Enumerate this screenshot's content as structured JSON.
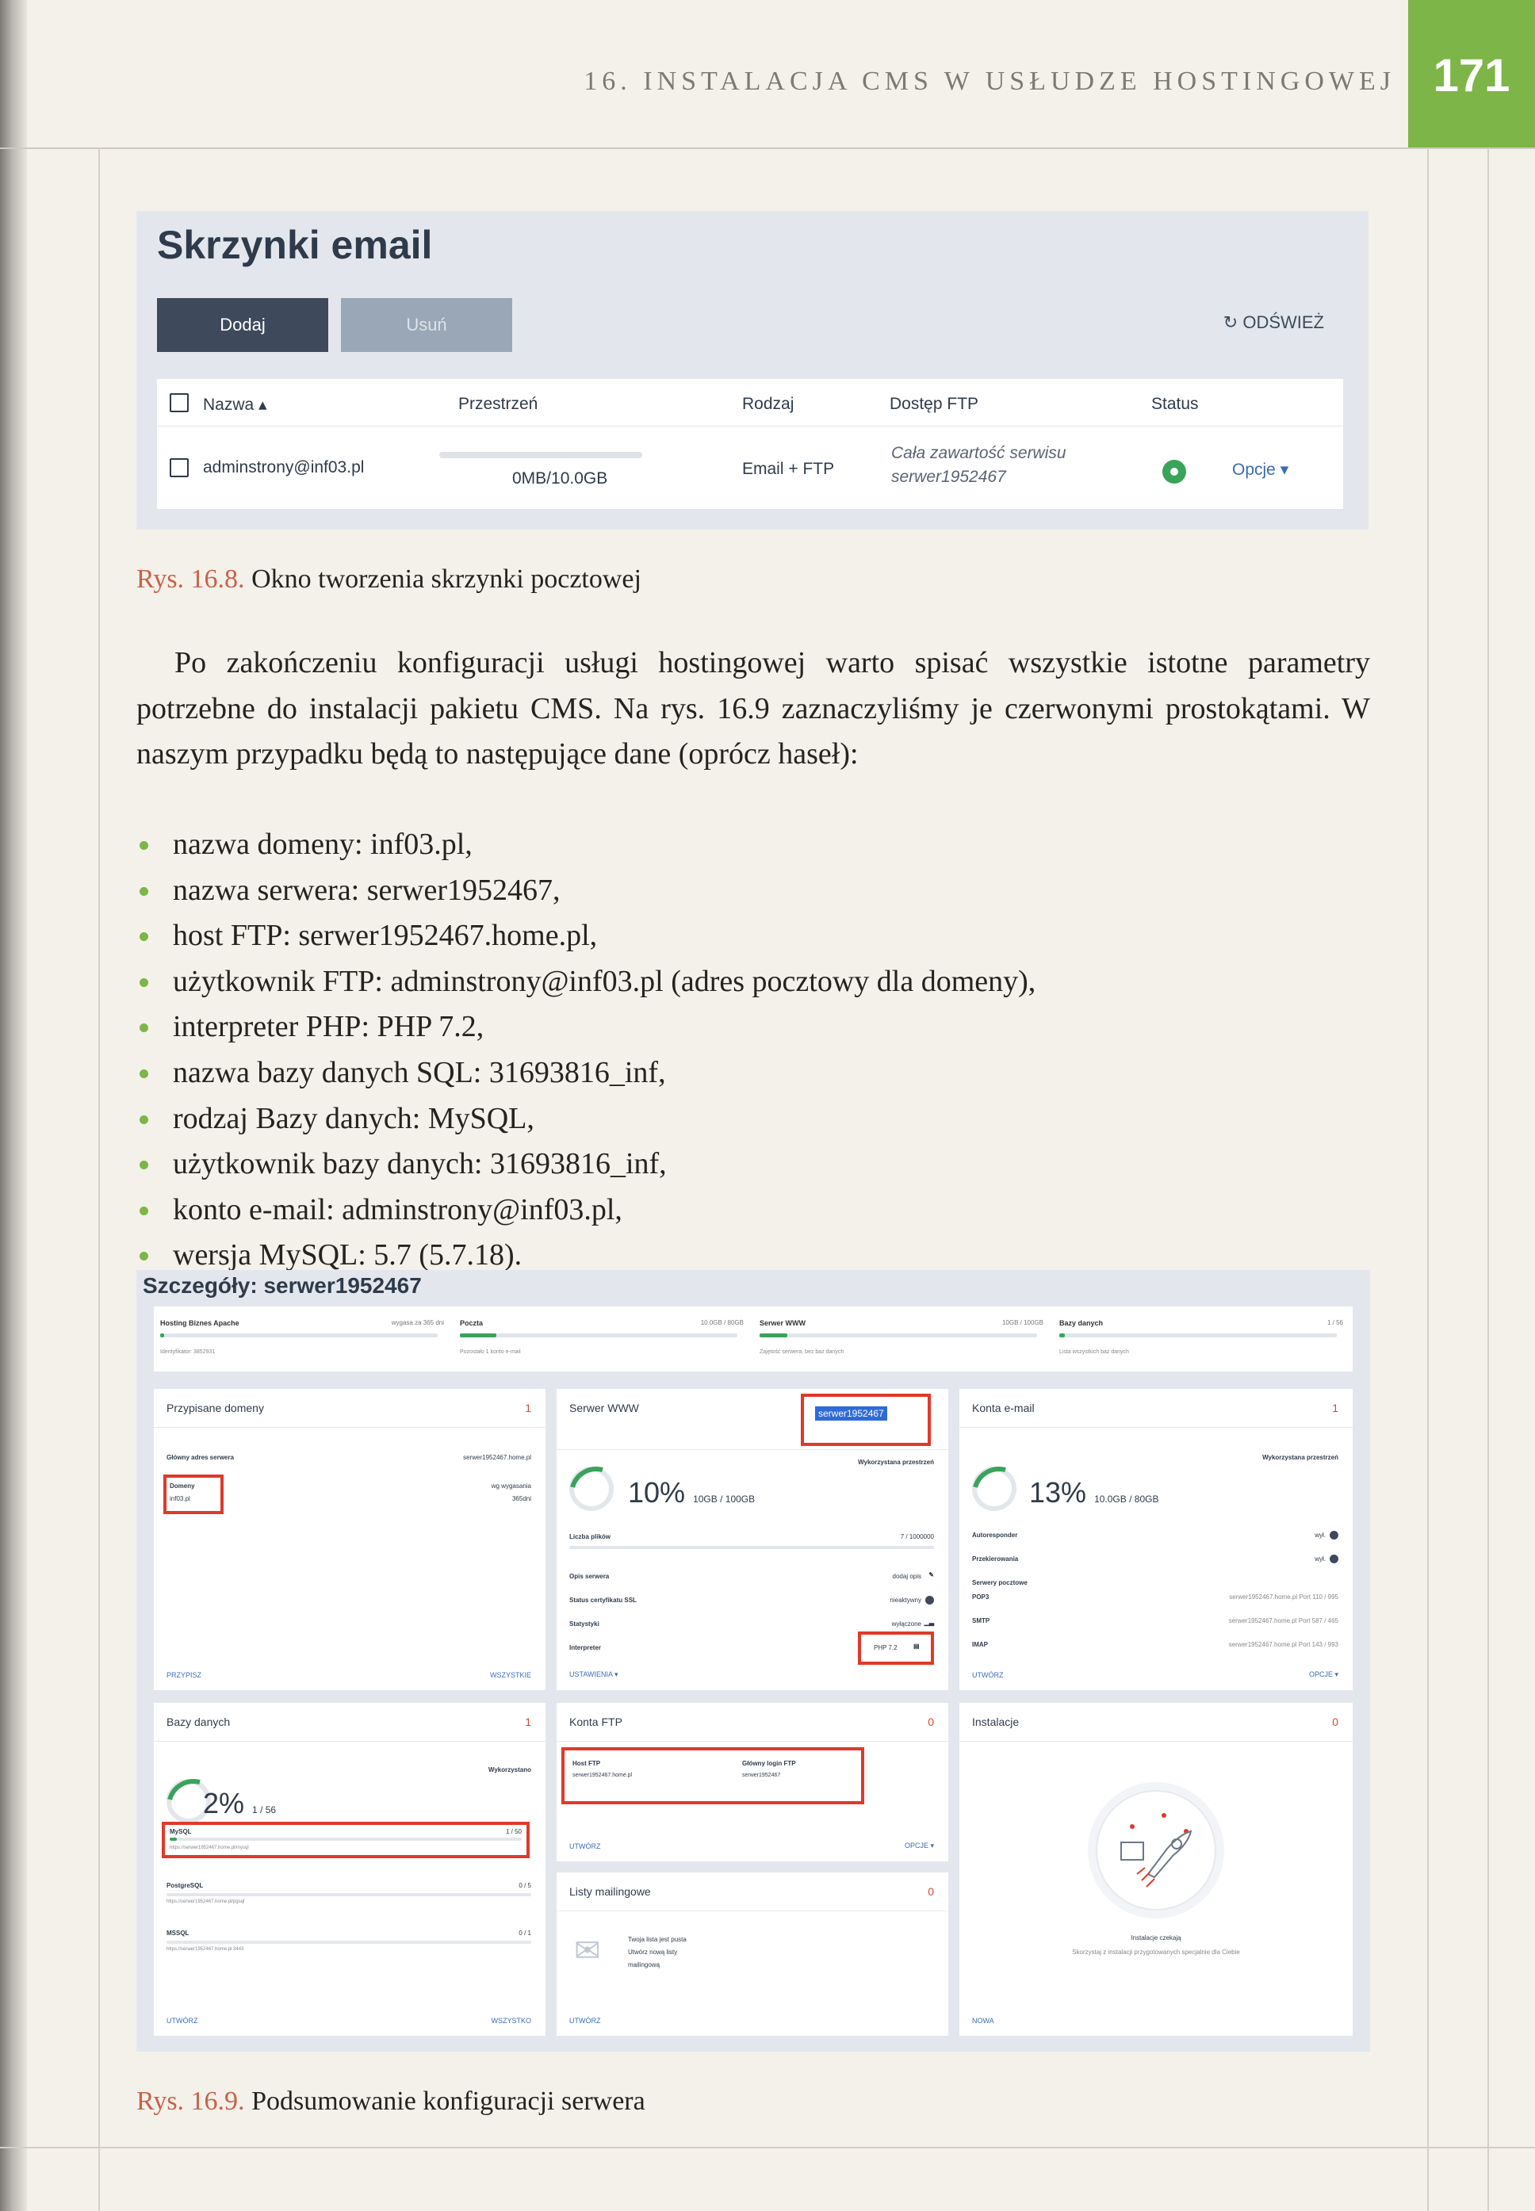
{
  "header": {
    "running_head": "16. INSTALACJA CMS W USŁUDZE HOSTINGOWEJ",
    "page_number": "171"
  },
  "fig1": {
    "title": "Skrzynki email",
    "add_label": "Dodaj",
    "delete_label": "Usuń",
    "refresh_label": "ODŚWIEŻ",
    "columns": [
      "Nazwa ▴",
      "Przestrzeń",
      "Rodzaj",
      "Dostęp FTP",
      "Status"
    ],
    "row": {
      "name": "adminstrony@inf03.pl",
      "space": "0MB/10.0GB",
      "type": "Email + FTP",
      "ftp_line1": "Cała zawartość serwisu",
      "ftp_line2": "serwer1952467",
      "options": "Opcje ▾"
    },
    "caption_num": "Rys. 16.8.",
    "caption_text": "Okno tworzenia skrzynki pocztowej"
  },
  "body": {
    "paragraph": "Po zakończeniu konfiguracji usługi hostingowej warto spisać wszystkie istotne parametry potrzebne do instalacji pakietu CMS. Na rys. 16.9 zaznaczyliśmy je czerwonymi prostokątami. W naszym przypadku będą to następujące dane (oprócz haseł):",
    "bullets": [
      "nazwa domeny: inf03.pl,",
      "nazwa serwera: serwer1952467,",
      "host FTP: serwer1952467.home.pl,",
      "użytkownik FTP: adminstrony@inf03.pl (adres pocztowy dla domeny),",
      "interpreter PHP: PHP 7.2,",
      "nazwa bazy danych SQL: 31693816_inf,",
      "rodzaj Bazy danych: MySQL,",
      "użytkownik bazy danych: 31693816_inf,",
      "konto e-mail: adminstrony@inf03.pl,",
      "wersja MySQL: 5.7 (5.7.18)."
    ]
  },
  "fig2": {
    "title": "Szczegóły: serwer1952467",
    "strip": [
      {
        "title": "Hosting Biznes Apache",
        "value": "wygasa za 365 dni",
        "sub": "Identyfikator: 3852931",
        "fill": 0.01
      },
      {
        "title": "Poczta",
        "value": "10.0GB / 80GB",
        "sub": "Pozostało 1 konto e-mail",
        "fill": 0.13
      },
      {
        "title": "Serwer WWW",
        "value": "10GB / 100GB",
        "sub": "Zajętość serwera, bez baz danych",
        "fill": 0.1
      },
      {
        "title": "Bazy danych",
        "value": "1 / 56",
        "sub": "Lista wszystkich baz danych",
        "fill": 0.02
      }
    ],
    "domains": {
      "title": "Przypisane domeny",
      "count": "1",
      "main_label": "Główny adres serwera",
      "main_value": "serwer1952467.home.pl",
      "domains_label": "Domeny",
      "domain": "inf03.pl",
      "expiry_label": "wg wygasania",
      "expiry_value": "365dni",
      "foot_left": "PRZYPISZ",
      "foot_right": "WSZYSTKIE"
    },
    "www": {
      "title": "Serwer WWW",
      "server": "serwer1952467",
      "used_label": "Wykorzystana przestrzeń",
      "percent": "10%",
      "amount": "10GB / 100GB",
      "files_label": "Liczba plików",
      "files_value": "7 / 1000000",
      "desc_label": "Opis serwera",
      "desc_value": "dodaj opis",
      "ssl_label": "Status certyfikatu SSL",
      "ssl_value": "nieaktywny",
      "stats_label": "Statystyki",
      "stats_value": "wyłączone",
      "php_label": "Interpreter",
      "php_value": "PHP 7.2",
      "foot_left": "USTAWIENIA ▾"
    },
    "mail": {
      "title": "Konta e-mail",
      "count": "1",
      "used_label": "Wykorzystana przestrzeń",
      "percent": "13%",
      "amount": "10.0GB / 80GB",
      "rows": [
        {
          "label": "Autoresponder",
          "value": "wył."
        },
        {
          "label": "Przekierowania",
          "value": "wył."
        },
        {
          "label": "Serwery pocztowe",
          "value": ""
        },
        {
          "label": "POP3",
          "value": "serwer1952467.home.pl   Port 110 / 995"
        },
        {
          "label": "SMTP",
          "value": "serwer1952467.home.pl   Port 587 / 465"
        },
        {
          "label": "IMAP",
          "value": "serwer1952467.home.pl   Port 143 / 993"
        }
      ],
      "foot_left": "UTWÓRZ",
      "foot_right": "OPCJE ▾"
    },
    "db": {
      "title": "Bazy danych",
      "count": "1",
      "used_label": "Wykorzystano",
      "percent": "2%",
      "amount": "1 / 56",
      "rows": [
        {
          "name": "MySQL",
          "count": "1 / 50",
          "url": "https://serwer1952467.home.pl/mysql",
          "fill": 0.02
        },
        {
          "name": "PostgreSQL",
          "count": "0 / 5",
          "url": "https://serwer1952467.home.pl/pgsql",
          "fill": 0
        },
        {
          "name": "MSSQL",
          "count": "0 / 1",
          "url": "https://serwer1952467.home.pl:3443",
          "fill": 0
        }
      ],
      "foot_left": "UTWÓRZ",
      "foot_right": "WSZYSTKO"
    },
    "ftp": {
      "title": "Konta FTP",
      "count": "0",
      "host_label": "Host FTP",
      "host_value": "serwer1952467.home.pl",
      "login_label": "Główny login FTP",
      "login_value": "serwer1952467",
      "foot_left": "UTWÓRZ",
      "foot_right": "OPCJE ▾"
    },
    "lists": {
      "title": "Listy mailingowe",
      "count": "0",
      "empty1": "Twoja lista jest pusta",
      "empty2": "Utwórz nową listy",
      "empty3": "mailingową",
      "foot_left": "UTWÓRZ"
    },
    "installs": {
      "title": "Instalacje",
      "count": "0",
      "empty_title": "Instalacje czekają",
      "empty_text": "Skorzystaj z instalacji przygotowanych specjalnie dla Ciebie",
      "foot_left": "NOWA"
    },
    "caption_num": "Rys. 16.9.",
    "caption_text": "Podsumowanie konfiguracji serwera"
  }
}
